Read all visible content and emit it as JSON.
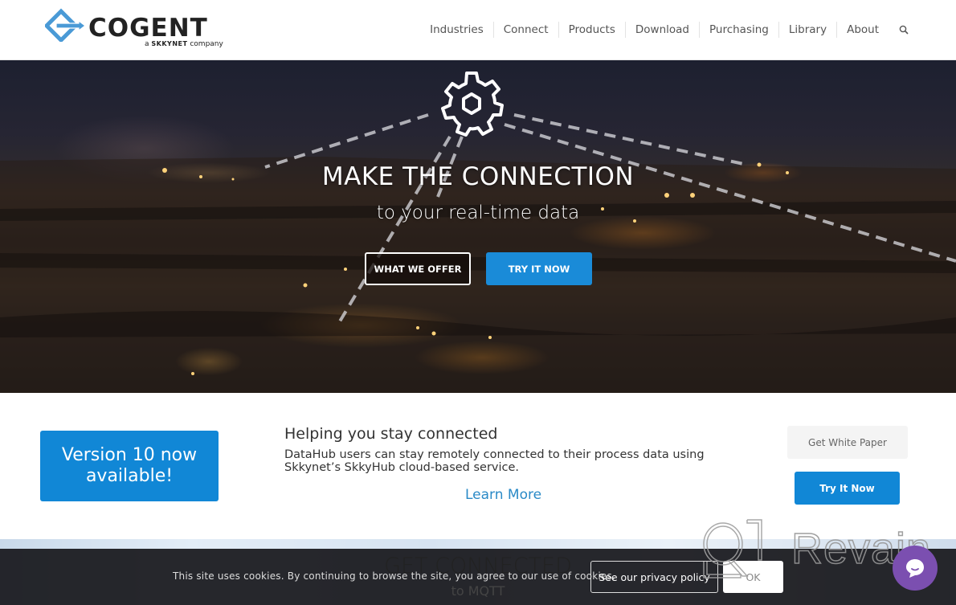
{
  "header": {
    "logo": {
      "brand": "COGENT",
      "tagline_prefix": "a",
      "tagline_brand": "SKKYNET",
      "tagline_suffix": "company",
      "brand_color": "#222222",
      "mark_color": "#4a9ad6"
    },
    "nav": [
      {
        "label": "Industries"
      },
      {
        "label": "Connect"
      },
      {
        "label": "Products"
      },
      {
        "label": "Download"
      },
      {
        "label": "Purchasing"
      },
      {
        "label": "Library"
      },
      {
        "label": "About"
      }
    ],
    "search_icon": "search-icon"
  },
  "hero": {
    "icon": "gear-icon",
    "title": "MAKE THE CONNECTION",
    "subtitle": "to your real-time data",
    "buttons": {
      "offer": "WHAT WE OFFER",
      "try": "TRY IT NOW"
    },
    "accent_color": "#1a8bd8"
  },
  "promo": {
    "version_banner": "Version 10 now available!",
    "title": "Helping you stay connected",
    "text": "DataHub users can stay remotely connected to their process data using Skkynet’s SkkyHub cloud-based service.",
    "learn_more": "Learn More",
    "white_paper_button": "Get White Paper",
    "try_button": "Try It Now",
    "accent_color": "#1187d6",
    "link_color": "#2a8ac7"
  },
  "next_section": {
    "title": "GET CONNECTED",
    "subtitle": "to MQTT"
  },
  "cookie_bar": {
    "text": "This site uses cookies. By continuing to browse the site, you agree to our use of cookies.",
    "privacy_button": "See our privacy policy",
    "ok_button": "OK"
  },
  "chat": {
    "icon": "chat-bubble-icon",
    "color": "#7b4fb0"
  },
  "watermark": {
    "text": "Revain"
  }
}
